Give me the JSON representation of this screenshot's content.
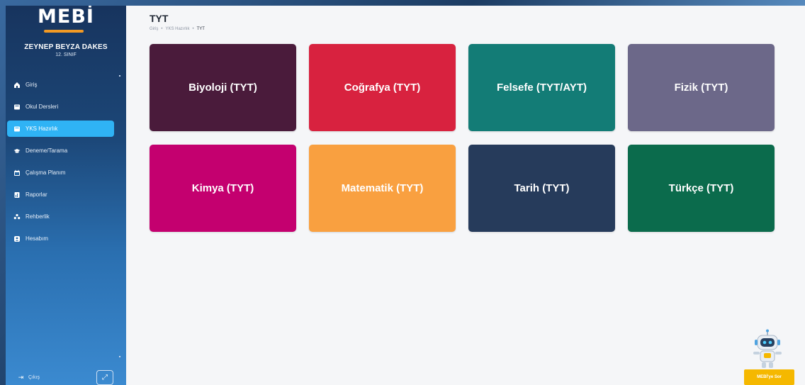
{
  "sidebar": {
    "logo": "MEBİ",
    "user_name": "ZEYNEP BEYZA DAKES",
    "user_class": "12. SINIF",
    "items": [
      {
        "label": "Giriş",
        "icon": "home-icon",
        "active": false
      },
      {
        "label": "Okul Dersleri",
        "icon": "book-icon",
        "active": false
      },
      {
        "label": "YKS Hazırlık",
        "icon": "book-icon",
        "active": true
      },
      {
        "label": "Deneme/Tarama",
        "icon": "graduation-cap-icon",
        "active": false
      },
      {
        "label": "Çalışma Planım",
        "icon": "calendar-icon",
        "active": false
      },
      {
        "label": "Raporlar",
        "icon": "report-icon",
        "active": false
      },
      {
        "label": "Rehberlik",
        "icon": "people-icon",
        "active": false
      },
      {
        "label": "Hesabım",
        "icon": "user-icon",
        "active": false
      }
    ],
    "logout_label": "Çıkış"
  },
  "header": {
    "title": "TYT",
    "breadcrumb": [
      "Giriş",
      "YKS Hazırlık",
      "TYT"
    ]
  },
  "subjects": [
    {
      "label": "Biyoloji (TYT)",
      "color": "#4a1b3b"
    },
    {
      "label": "Coğrafya (TYT)",
      "color": "#d8223f"
    },
    {
      "label": "Felsefe (TYT/AYT)",
      "color": "#137c76"
    },
    {
      "label": "Fizik (TYT)",
      "color": "#6c6889"
    },
    {
      "label": "Kimya (TYT)",
      "color": "#c4006f"
    },
    {
      "label": "Matematik (TYT)",
      "color": "#f9a040"
    },
    {
      "label": "Tarih (TYT)",
      "color": "#263b5b"
    },
    {
      "label": "Türkçe (TYT)",
      "color": "#0b6b4c"
    }
  ],
  "assistant": {
    "button_label": "MEBİ'ye Sor"
  },
  "colors": {
    "active_nav": "#2fb3f5",
    "accent": "#f39a24",
    "ask_button": "#f5b800"
  }
}
